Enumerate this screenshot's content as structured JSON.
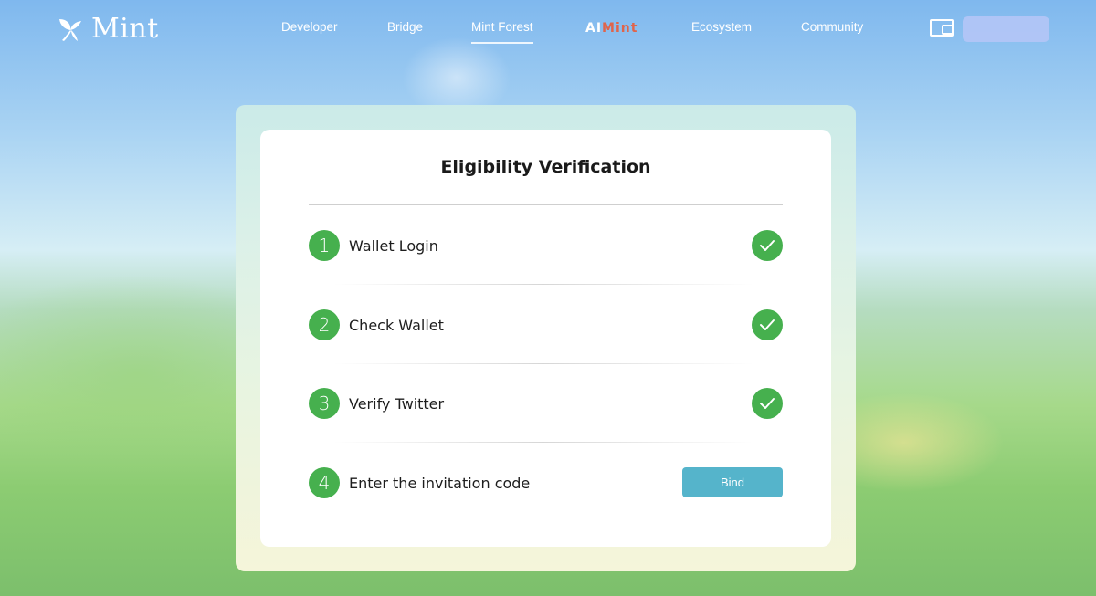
{
  "brand": {
    "name": "Mint"
  },
  "nav": {
    "items": [
      {
        "label": "Developer"
      },
      {
        "label": "Bridge"
      },
      {
        "label": "Mint Forest"
      },
      {
        "label": "Ecosystem"
      },
      {
        "label": "Community"
      }
    ],
    "active": "Mint Forest",
    "aimint": {
      "ai": "AI",
      "mint": "Mint"
    }
  },
  "card": {
    "title": "Eligibility Verification",
    "steps": [
      {
        "number": "1",
        "label": "Wallet Login",
        "status": "completed"
      },
      {
        "number": "2",
        "label": "Check Wallet",
        "status": "completed"
      },
      {
        "number": "3",
        "label": "Verify Twitter",
        "status": "completed"
      },
      {
        "number": "4",
        "label": "Enter the invitation code",
        "status": "pending",
        "action_label": "Bind"
      }
    ]
  },
  "colors": {
    "step_green": "#46b04e",
    "bind_button": "#55b4cb",
    "connect_button": "#b4c5f6"
  }
}
